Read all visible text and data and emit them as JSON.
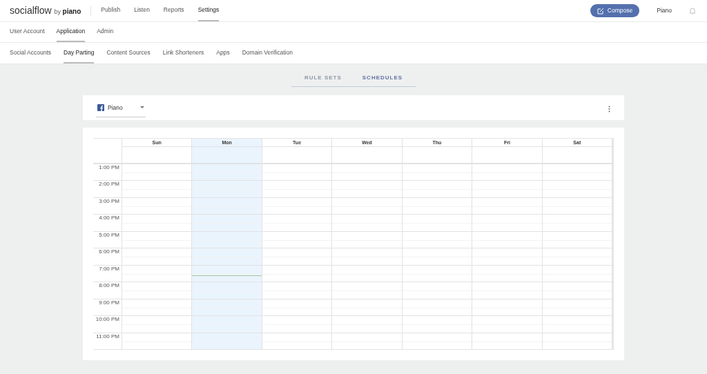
{
  "brand": {
    "name": "socialflow",
    "by": "by",
    "partner": "piano"
  },
  "main_nav": [
    {
      "label": "Publish",
      "selected": false
    },
    {
      "label": "Listen",
      "selected": false
    },
    {
      "label": "Reports",
      "selected": false
    },
    {
      "label": "Settings",
      "selected": true
    }
  ],
  "compose_button": "Compose",
  "account": "Piano",
  "settings_nav": [
    {
      "label": "User Account",
      "selected": false
    },
    {
      "label": "Application",
      "selected": true
    },
    {
      "label": "Admin",
      "selected": false
    }
  ],
  "application_nav": [
    {
      "label": "Social Accounts",
      "selected": false
    },
    {
      "label": "Day Parting",
      "selected": true
    },
    {
      "label": "Content Sources",
      "selected": false
    },
    {
      "label": "Link Shorteners",
      "selected": false
    },
    {
      "label": "Apps",
      "selected": false
    },
    {
      "label": "Domain Verification",
      "selected": false
    }
  ],
  "view_tabs": [
    {
      "label": "RULE SETS",
      "selected": false
    },
    {
      "label": "SCHEDULES",
      "selected": true
    }
  ],
  "account_select": {
    "value": "Piano"
  },
  "calendar": {
    "days": [
      {
        "label": "Sun",
        "today": false
      },
      {
        "label": "Mon",
        "today": true
      },
      {
        "label": "Tue",
        "today": false
      },
      {
        "label": "Wed",
        "today": false
      },
      {
        "label": "Thu",
        "today": false
      },
      {
        "label": "Fri",
        "today": false
      },
      {
        "label": "Sat",
        "today": false
      }
    ],
    "hours": [
      "1:00 PM",
      "2:00 PM",
      "3:00 PM",
      "4:00 PM",
      "5:00 PM",
      "6:00 PM",
      "7:00 PM",
      "8:00 PM",
      "9:00 PM",
      "10:00 PM",
      "11:00 PM"
    ]
  }
}
